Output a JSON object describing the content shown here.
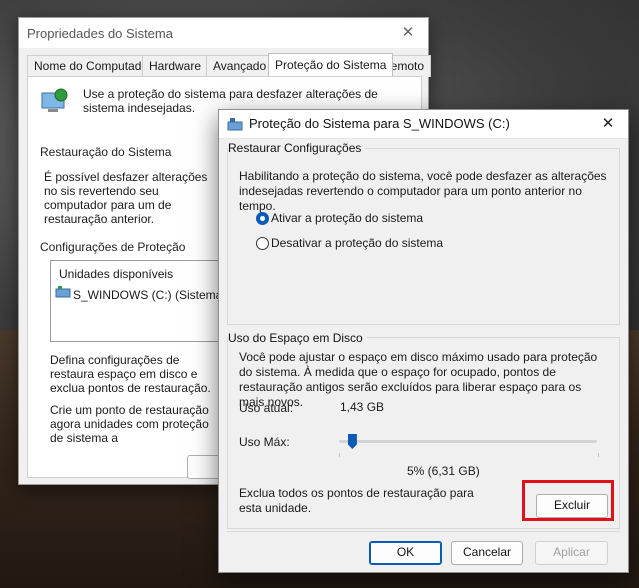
{
  "back_window": {
    "title": "Propriedades do Sistema",
    "tabs": [
      "Nome do Computador",
      "Hardware",
      "Avançado",
      "Proteção do Sistema",
      "Remoto"
    ],
    "active_tab": "Proteção do Sistema",
    "intro": "Use a proteção do sistema para desfazer alterações de sistema indesejadas.",
    "restore_heading": "Restauração do Sistema",
    "restore_text": "É possível desfazer alterações no sis revertendo seu computador para um de restauração anterior.",
    "config_heading": "Configurações de Proteção",
    "drives_header": "Unidades disponíveis",
    "drive_item": "S_WINDOWS (C:) (Sistema)",
    "configure_text": "Defina configurações de restaura espaço em disco e exclua pontos de restauração.",
    "create_text": "Crie um ponto de restauração agora unidades com proteção de sistema a"
  },
  "dialog": {
    "title": "Proteção do Sistema para S_WINDOWS (C:)",
    "restore_settings": {
      "label": "Restaurar Configurações",
      "description": "Habilitando a proteção do sistema, você pode desfazer as alterações indesejadas revertendo o computador para um ponto anterior no tempo.",
      "option_on": "Ativar a proteção do sistema",
      "option_off": "Desativar a proteção do sistema",
      "selected": "on"
    },
    "disk_usage": {
      "label": "Uso do Espaço em Disco",
      "description": "Você pode ajustar o espaço em disco máximo usado para proteção do sistema. À medida que o espaço for ocupado, pontos de restauração antigos serão excluídos para liberar espaço para os mais novos.",
      "current_label": "Uso atual:",
      "current_value": "1,43 GB",
      "max_label": "Uso Máx:",
      "max_percent_value": 5,
      "max_value_text": "5% (6,31 GB)",
      "delete_text": "Exclua todos os pontos de restauração para esta unidade.",
      "delete_button": "Excluir"
    },
    "buttons": {
      "ok": "OK",
      "cancel": "Cancelar",
      "apply": "Aplicar"
    }
  },
  "colors": {
    "accent": "#0a5bb8",
    "highlight": "#e0111b"
  }
}
